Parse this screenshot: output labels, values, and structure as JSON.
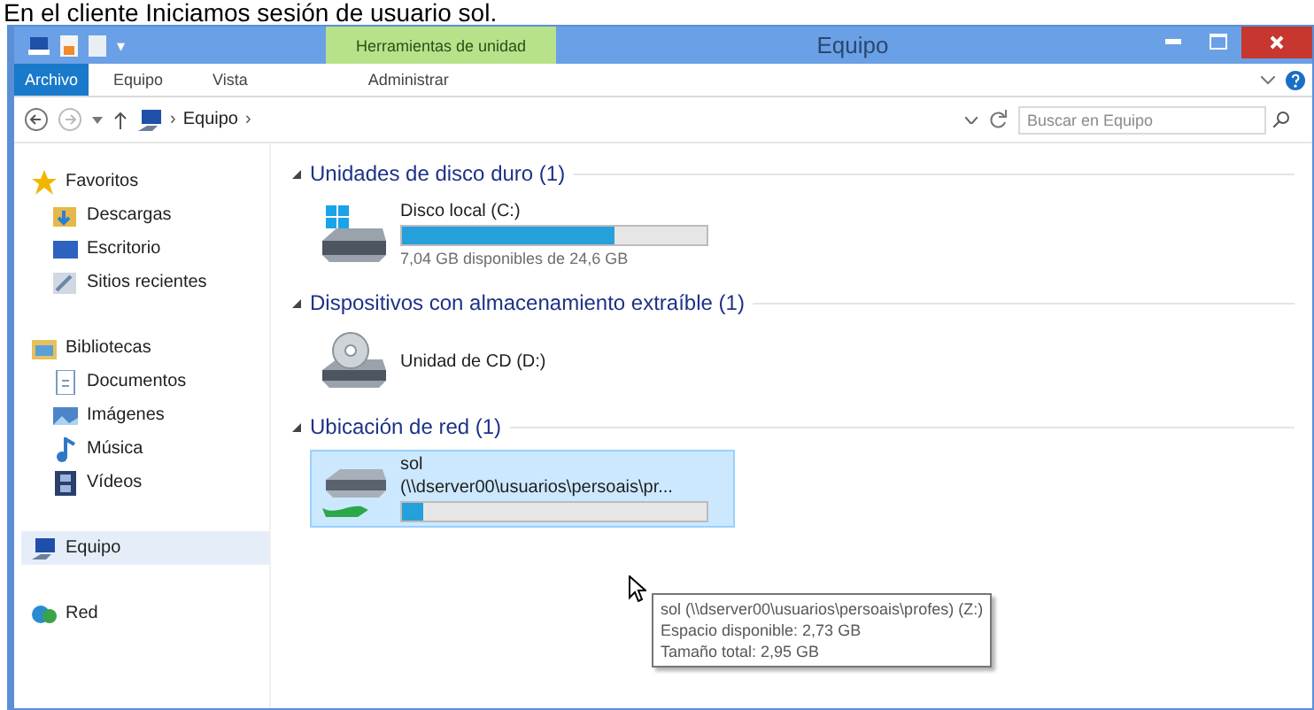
{
  "caption": "En el cliente Iniciamos sesión de usuario sol.",
  "window": {
    "title": "Equipo",
    "context_tab": "Herramientas de unidad",
    "quick_access_caret": "▾"
  },
  "ribbon_tabs": [
    {
      "label": "Archivo",
      "selected": false,
      "kind": "file"
    },
    {
      "label": "Equipo",
      "selected": false,
      "kind": "tab"
    },
    {
      "label": "Vista",
      "selected": false,
      "kind": "tab"
    },
    {
      "label": "Administrar",
      "selected": false,
      "kind": "tab"
    }
  ],
  "address": {
    "parts": [
      {
        "kind": "separator",
        "text": "›"
      },
      {
        "kind": "crumb",
        "text": "Equipo"
      },
      {
        "kind": "separator",
        "text": "›"
      }
    ],
    "search_placeholder": "Buscar en Equipo"
  },
  "sidebar": [
    {
      "label": "Favoritos",
      "selected": false,
      "children": [
        {
          "label": "Descargas",
          "selected": false
        },
        {
          "label": "Escritorio",
          "selected": false
        },
        {
          "label": "Sitios recientes",
          "selected": false
        }
      ]
    },
    {
      "label": "Bibliotecas",
      "selected": false,
      "children": [
        {
          "label": "Documentos",
          "selected": false
        },
        {
          "label": "Imágenes",
          "selected": false
        },
        {
          "label": "Música",
          "selected": false
        },
        {
          "label": "Vídeos",
          "selected": false
        }
      ]
    },
    {
      "label": "Equipo",
      "selected": true
    },
    {
      "label": "Red",
      "selected": false
    }
  ],
  "sections": [
    {
      "heading": "Unidades de disco duro (1)",
      "items": [
        {
          "kind": "disk",
          "name": "Disco local (C:)",
          "level": 0.7,
          "detail": "7,04 GB disponibles de 24,6 GB",
          "selected": false
        }
      ]
    },
    {
      "heading": "Dispositivos con almacenamiento extraíble (1)",
      "items": [
        {
          "kind": "cd",
          "name": "Unidad de CD (D:)",
          "selected": false
        }
      ]
    },
    {
      "heading": "Ubicación de red (1)",
      "items": [
        {
          "kind": "network",
          "name": "sol",
          "path": "(\\\\dserver00\\usuarios\\persoais\\pr...",
          "level": 0.07,
          "selected": true
        }
      ]
    }
  ],
  "tooltip": [
    "sol (\\\\dserver00\\usuarios\\persoais\\profes) (Z:)",
    "Espacio disponible: 2,73 GB",
    "Tamaño total: 2,95 GB"
  ]
}
